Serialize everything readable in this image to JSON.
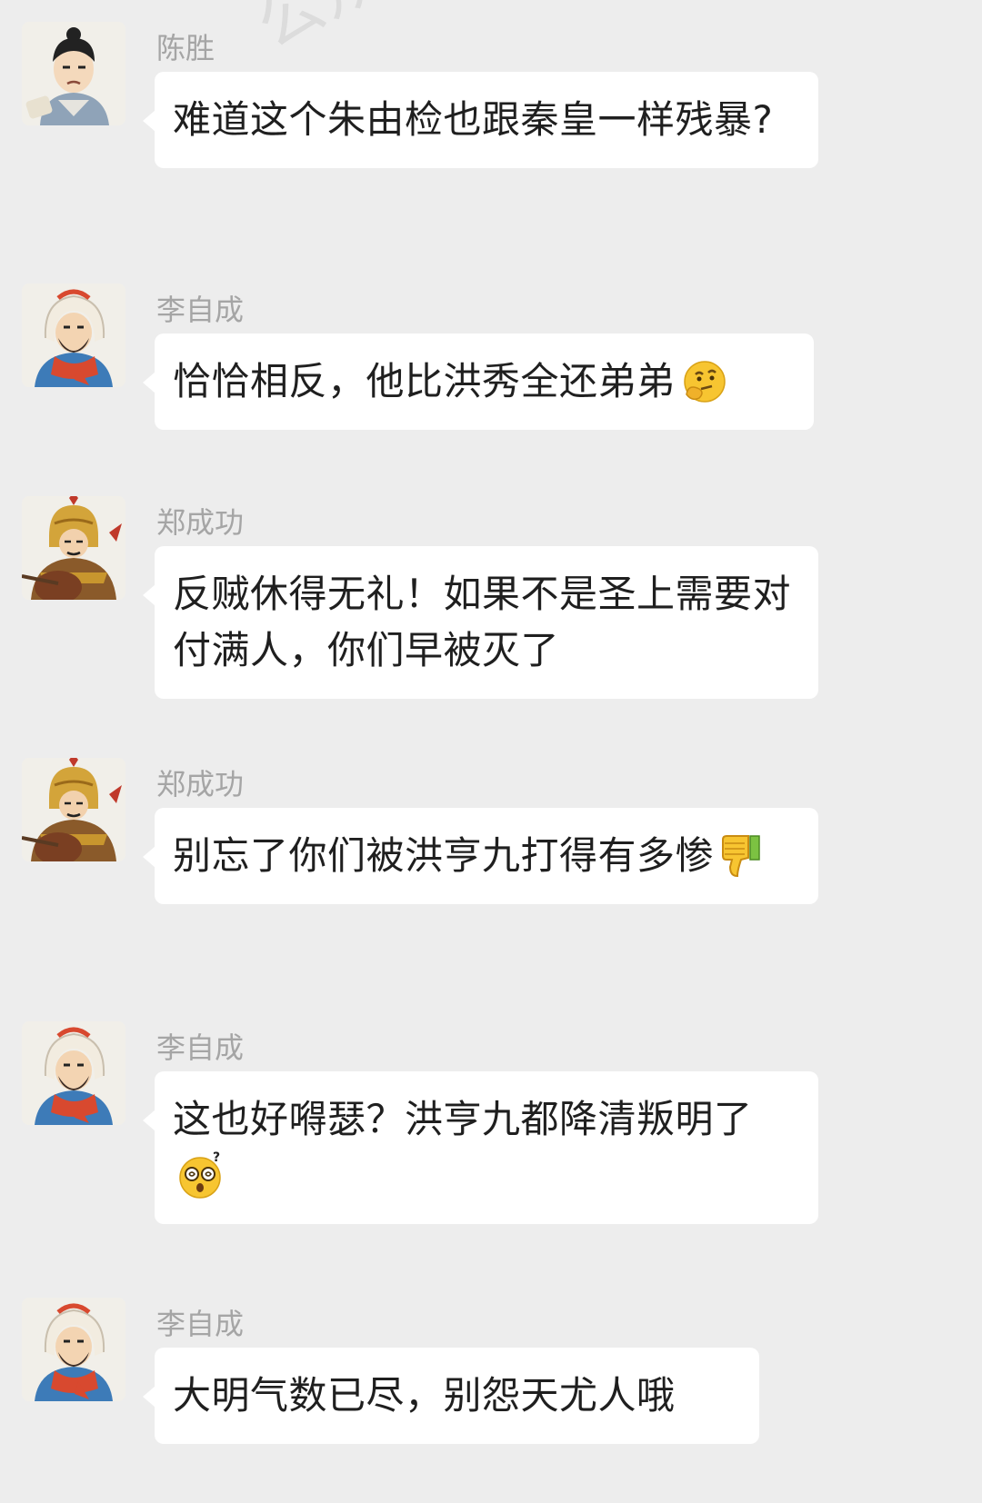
{
  "watermark": "公众号:曲",
  "messages": [
    {
      "sender": "陈胜",
      "avatar_icon": "scholar-avatar-icon",
      "text": "难道这个朱由检也跟秦皇一样残暴?",
      "emoji": null
    },
    {
      "sender": "李自成",
      "avatar_icon": "hooded-rebel-avatar-icon",
      "text": "恰恰相反，他比洪秀全还弟弟",
      "emoji": "thinking-face-icon"
    },
    {
      "sender": "郑成功",
      "avatar_icon": "armored-general-avatar-icon",
      "text": "反贼休得无礼！如果不是圣上需要对付满人，你们早被灭了",
      "emoji": null
    },
    {
      "sender": "郑成功",
      "avatar_icon": "armored-general-avatar-icon",
      "text": "别忘了你们被洪亨九打得有多惨",
      "emoji": "thumbs-down-icon"
    },
    {
      "sender": "李自成",
      "avatar_icon": "hooded-rebel-avatar-icon",
      "text": "这也好嘚瑟？洪亨九都降清叛明了",
      "emoji": "dizzy-face-icon"
    },
    {
      "sender": "李自成",
      "avatar_icon": "hooded-rebel-avatar-icon",
      "text": "大明气数已尽，别怨天尤人哦",
      "emoji": null
    }
  ],
  "colors": {
    "background": "#ededed",
    "bubble": "#ffffff",
    "sender_text": "#a5a5a5",
    "message_text": "#1f1f1f"
  }
}
